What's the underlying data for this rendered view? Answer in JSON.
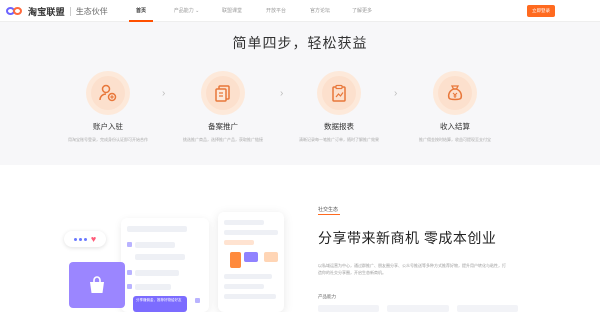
{
  "nav": {
    "logo_text": "淘宝联盟",
    "logo_sub": "生态伙伴",
    "menu": [
      {
        "label": "首页",
        "active": true
      },
      {
        "label": "产品能力 ⌄",
        "active": false
      },
      {
        "label": "联盟课堂",
        "active": false
      },
      {
        "label": "开放平台",
        "active": false
      },
      {
        "label": "官方论坛",
        "active": false
      },
      {
        "label": "了解更多",
        "active": false
      }
    ],
    "login_label": "立即登录"
  },
  "steps": {
    "title": "简单四步，轻松获益",
    "items": [
      {
        "icon": "user-register-icon",
        "title": "账户入驻",
        "desc": "用淘宝账号登录，完成身份认证即可开始合作"
      },
      {
        "icon": "document-copy-icon",
        "title": "备案推广",
        "desc": "挑选推广商品，选择推广产品，获取推广链接"
      },
      {
        "icon": "clipboard-report-icon",
        "title": "数据报表",
        "desc": "清晰记录每一笔推广订单，随时了解推广效果"
      },
      {
        "icon": "money-bag-icon",
        "title": "收入结算",
        "desc": "推广佣金按时结算，收益可提现至支付宝"
      }
    ]
  },
  "eco": {
    "tag": "社交生态",
    "title": "分享带来新商机 零成本创业",
    "desc": "以私域运营为中心，通过群推广、朋友圈分享、公众号推送等多种方式推荐好物，提升用户转化与粘性，打造你的社交分享圈，开启生态新商机。",
    "ability_label": "产品能力",
    "share_tag": "分享赚佣金，推荐好物给好友"
  },
  "colors": {
    "brand": "#ff5000",
    "accent_purple": "#7c6cff",
    "step_icon_bg": "#fde9da"
  }
}
